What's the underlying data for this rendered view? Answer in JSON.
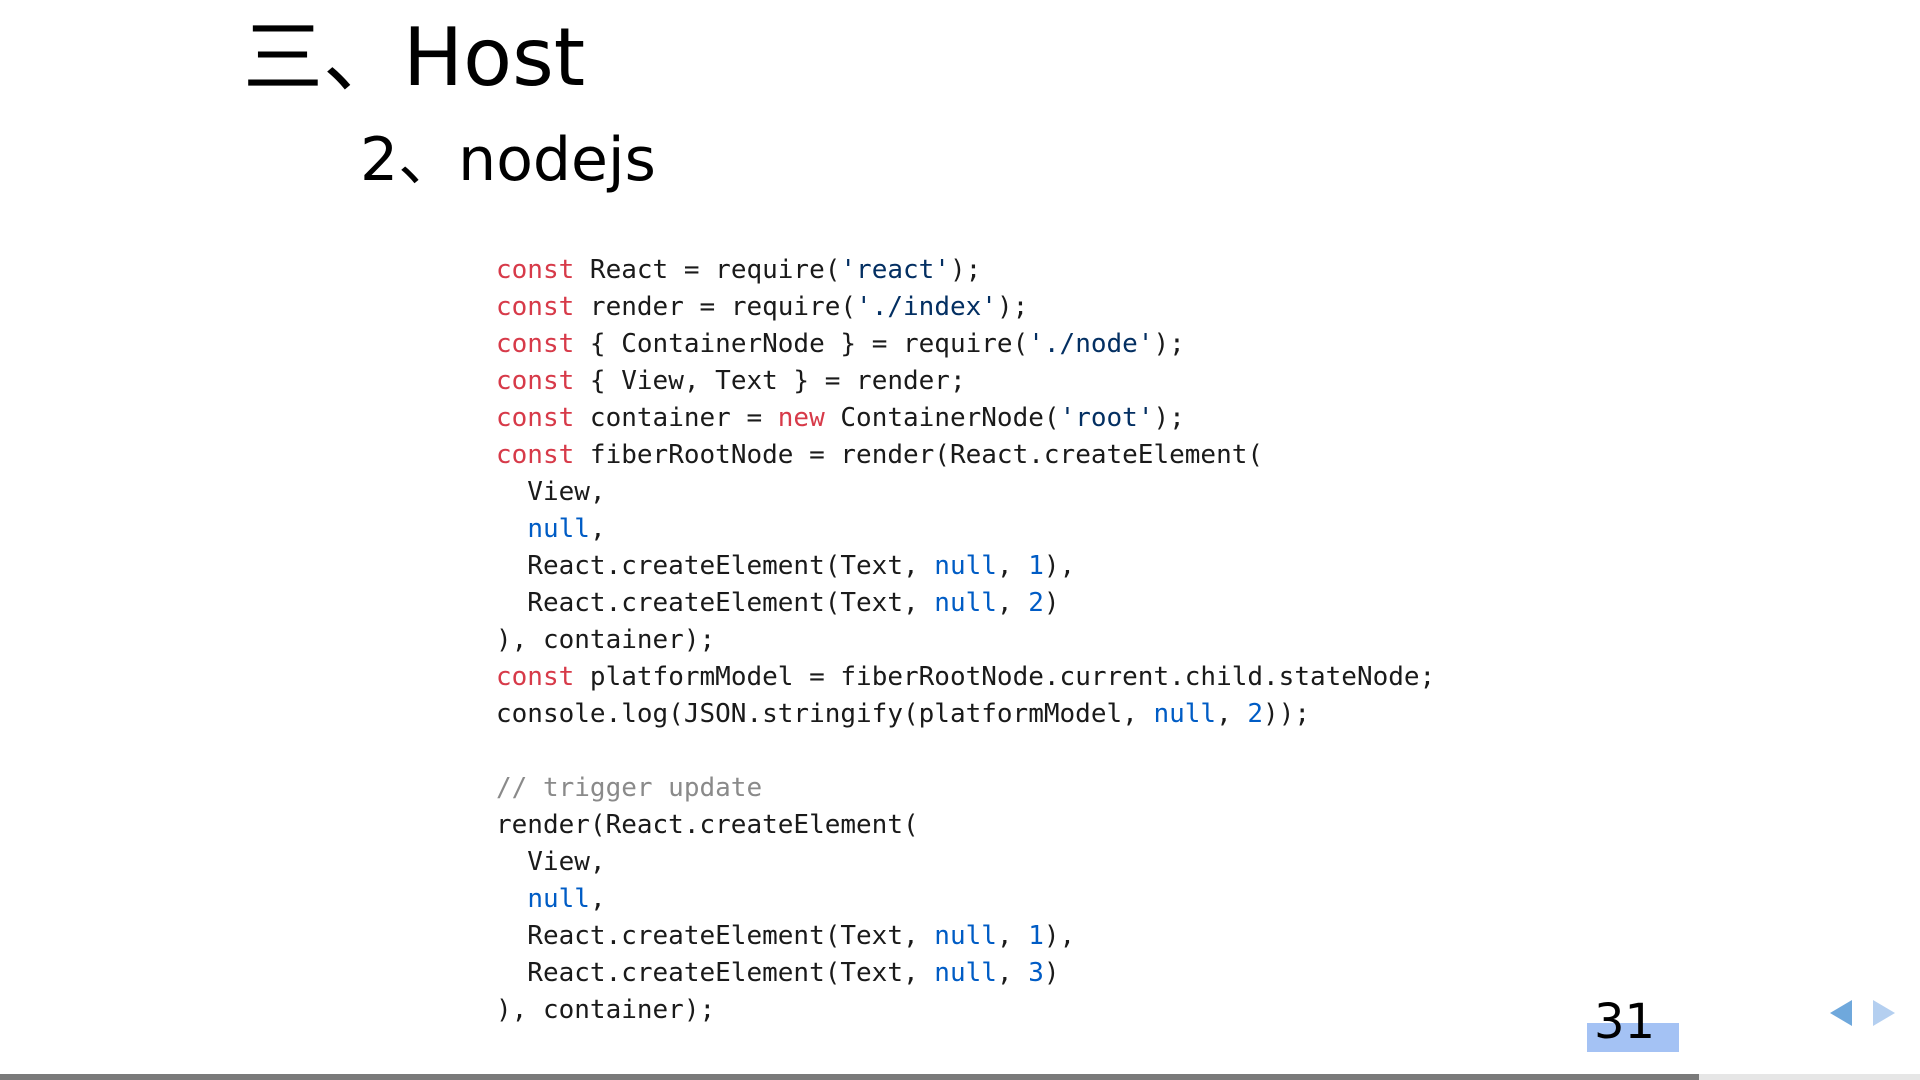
{
  "slide": {
    "title": "三、Host",
    "subtitle": "2、nodejs",
    "page_number": "31",
    "progress_fraction": 0.885
  },
  "code": {
    "lines": [
      [
        {
          "t": "const",
          "c": "kw"
        },
        {
          "t": " React = require("
        },
        {
          "t": "'react'",
          "c": "str"
        },
        {
          "t": ");"
        }
      ],
      [
        {
          "t": "const",
          "c": "kw"
        },
        {
          "t": " render = require("
        },
        {
          "t": "'./index'",
          "c": "str"
        },
        {
          "t": ");"
        }
      ],
      [
        {
          "t": "const",
          "c": "kw"
        },
        {
          "t": " { ContainerNode } = require("
        },
        {
          "t": "'./node'",
          "c": "str"
        },
        {
          "t": ");"
        }
      ],
      [
        {
          "t": "const",
          "c": "kw"
        },
        {
          "t": " { View, Text } = render;"
        }
      ],
      [
        {
          "t": "const",
          "c": "kw"
        },
        {
          "t": " container = "
        },
        {
          "t": "new",
          "c": "kw"
        },
        {
          "t": " ContainerNode("
        },
        {
          "t": "'root'",
          "c": "str"
        },
        {
          "t": ");"
        }
      ],
      [
        {
          "t": "const",
          "c": "kw"
        },
        {
          "t": " fiberRootNode = render(React.createElement("
        }
      ],
      [
        {
          "t": "  View,"
        }
      ],
      [
        {
          "t": "  "
        },
        {
          "t": "null",
          "c": "lit"
        },
        {
          "t": ","
        }
      ],
      [
        {
          "t": "  React.createElement(Text, "
        },
        {
          "t": "null",
          "c": "lit"
        },
        {
          "t": ", "
        },
        {
          "t": "1",
          "c": "num"
        },
        {
          "t": "),"
        }
      ],
      [
        {
          "t": "  React.createElement(Text, "
        },
        {
          "t": "null",
          "c": "lit"
        },
        {
          "t": ", "
        },
        {
          "t": "2",
          "c": "num"
        },
        {
          "t": ")"
        }
      ],
      [
        {
          "t": "), container);"
        }
      ],
      [
        {
          "t": "const",
          "c": "kw"
        },
        {
          "t": " platformModel = fiberRootNode.current.child.stateNode;"
        }
      ],
      [
        {
          "t": "console.log(JSON.stringify(platformModel, "
        },
        {
          "t": "null",
          "c": "lit"
        },
        {
          "t": ", "
        },
        {
          "t": "2",
          "c": "num"
        },
        {
          "t": "));"
        }
      ],
      [],
      [
        {
          "t": "// trigger update",
          "c": "com"
        }
      ],
      [
        {
          "t": "render(React.createElement("
        }
      ],
      [
        {
          "t": "  View,"
        }
      ],
      [
        {
          "t": "  "
        },
        {
          "t": "null",
          "c": "lit"
        },
        {
          "t": ","
        }
      ],
      [
        {
          "t": "  React.createElement(Text, "
        },
        {
          "t": "null",
          "c": "lit"
        },
        {
          "t": ", "
        },
        {
          "t": "1",
          "c": "num"
        },
        {
          "t": "),"
        }
      ],
      [
        {
          "t": "  React.createElement(Text, "
        },
        {
          "t": "null",
          "c": "lit"
        },
        {
          "t": ", "
        },
        {
          "t": "3",
          "c": "num"
        },
        {
          "t": ")"
        }
      ],
      [
        {
          "t": "), container);"
        }
      ]
    ]
  },
  "nav": {
    "prev_icon": "triangle-left-icon",
    "next_icon": "triangle-right-icon"
  },
  "colors": {
    "keyword": "#d73a49",
    "string": "#032f62",
    "literal": "#005cc5",
    "comment": "#8a8a8a",
    "page_highlight": "#a4c2f4",
    "nav_active": "#6fa8dc",
    "nav_inactive": "#b4cff0",
    "progress": "#7a7a7a"
  }
}
